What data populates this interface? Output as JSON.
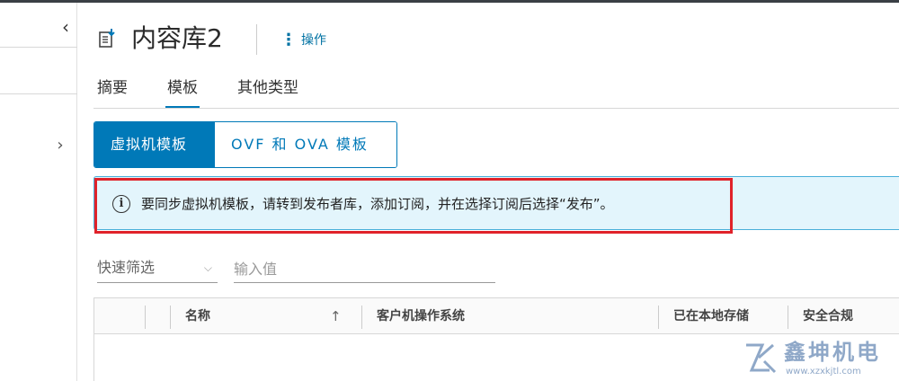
{
  "nav": {
    "collapse_glyph": "‹",
    "expand_glyph": "›"
  },
  "header": {
    "title": "内容库2",
    "actions_label": "操作",
    "actions_glyph": "⋮"
  },
  "tabs": [
    {
      "label": "摘要",
      "active": false
    },
    {
      "label": "模板",
      "active": true
    },
    {
      "label": "其他类型",
      "active": false
    }
  ],
  "segmented": {
    "vm_templates": "虚拟机模板",
    "ovf_ova_templates": "OVF 和 OVA 模板",
    "selected": "虚拟机模板"
  },
  "alert": {
    "icon": "info-icon",
    "icon_glyph": "i",
    "text": "要同步虚拟机模板，请转到发布者库，添加订阅，并在选择订阅后选择“发布”。"
  },
  "filter": {
    "quick_filter_label": "快速筛选",
    "chevron": "⌵",
    "value_placeholder": "输入值"
  },
  "grid": {
    "columns": [
      "名称",
      "客户机操作系统",
      "已在本地存储",
      "安全合规"
    ],
    "sort_glyph": "↑",
    "rows": []
  },
  "watermark": {
    "text": "鑫坤机电",
    "url": "www.xzxkjtl.com"
  },
  "colors": {
    "accent": "#0079b8",
    "alert_bg": "#e3f5fc",
    "alert_border": "#49afd9",
    "highlight": "#e0222a"
  }
}
